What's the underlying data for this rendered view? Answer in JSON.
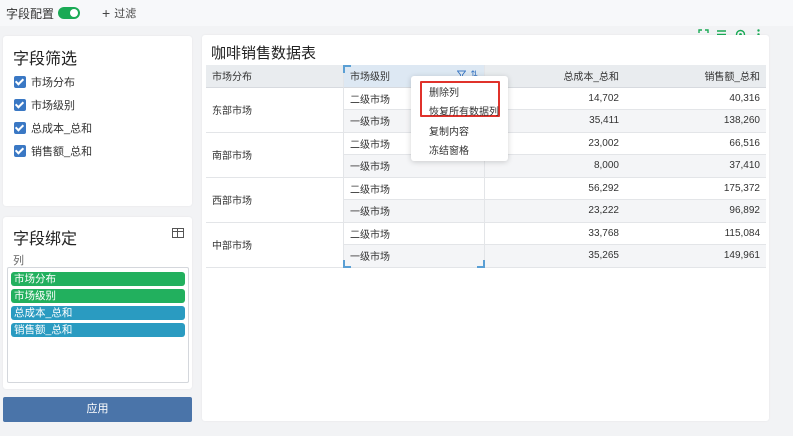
{
  "topbar": {
    "field_config_label": "字段配置",
    "toggle_on": true,
    "filter_label": "过滤",
    "filter_plus": "+"
  },
  "filter_panel": {
    "title": "字段筛选",
    "items": [
      {
        "label": "市场分布",
        "checked": true
      },
      {
        "label": "市场级别",
        "checked": true
      },
      {
        "label": "总成本_总和",
        "checked": true
      },
      {
        "label": "销售额_总和",
        "checked": true
      }
    ]
  },
  "bind_panel": {
    "title": "字段绑定",
    "col_label": "列",
    "chips": [
      {
        "label": "市场分布",
        "color": "#22b05e"
      },
      {
        "label": "市场级别",
        "color": "#22b05e"
      },
      {
        "label": "总成本_总和",
        "color": "#2a9bc1"
      },
      {
        "label": "销售额_总和",
        "color": "#2a9bc1"
      }
    ]
  },
  "apply_button": "应用",
  "main": {
    "title": "咖啡销售数据表",
    "toolbar_icons": [
      "expand-icon",
      "list-icon",
      "refresh-icon",
      "more-vertical-icon"
    ],
    "headers": [
      "市场分布",
      "市场级别",
      "总成本_总和",
      "销售额_总和"
    ],
    "regions": [
      "东部市场",
      "南部市场",
      "西部市场",
      "中部市场"
    ],
    "rows": [
      {
        "level": "二级市场",
        "cost": "14,702",
        "sales": "40,316"
      },
      {
        "level": "一级市场",
        "cost": "35,411",
        "sales": "138,260"
      },
      {
        "level": "二级市场",
        "cost": "23,002",
        "sales": "66,516"
      },
      {
        "level": "一级市场",
        "cost": "8,000",
        "sales": "37,410"
      },
      {
        "level": "二级市场",
        "cost": "56,292",
        "sales": "175,372"
      },
      {
        "level": "一级市场",
        "cost": "23,222",
        "sales": "96,892"
      },
      {
        "level": "二级市场",
        "cost": "33,768",
        "sales": "115,084"
      },
      {
        "level": "一级市场",
        "cost": "35,265",
        "sales": "149,961"
      }
    ]
  },
  "context_menu": {
    "items": [
      "删除列",
      "恢复所有数据列",
      "复制内容",
      "冻结窗格"
    ]
  },
  "colors": {
    "accent_green": "#1aaa55",
    "apply_blue": "#4a74a9",
    "highlight_red": "#e0322b"
  }
}
